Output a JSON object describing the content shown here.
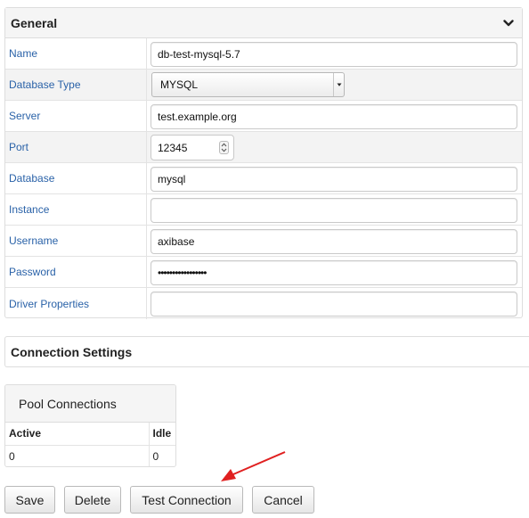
{
  "general": {
    "title": "General",
    "icon": "chevron-down-icon",
    "fields": [
      {
        "label": "Name",
        "value": "db-test-mysql-5.7",
        "type": "text"
      },
      {
        "label": "Database Type",
        "value": "MYSQL",
        "type": "select"
      },
      {
        "label": "Server",
        "value": "test.example.org",
        "type": "text"
      },
      {
        "label": "Port",
        "value": "12345",
        "type": "number"
      },
      {
        "label": "Database",
        "value": "mysql",
        "type": "text"
      },
      {
        "label": "Instance",
        "value": "",
        "type": "text"
      },
      {
        "label": "Username",
        "value": "axibase",
        "type": "text"
      },
      {
        "label": "Password",
        "value": "•••••••••••••••••",
        "type": "password"
      },
      {
        "label": "Driver Properties",
        "value": "",
        "type": "text"
      }
    ]
  },
  "connection_settings": {
    "title": "Connection Settings"
  },
  "pool": {
    "title": "Pool Connections",
    "headers": [
      "Active",
      "Idle"
    ],
    "rows": [
      [
        "0",
        "0"
      ]
    ]
  },
  "buttons": {
    "save": "Save",
    "delete": "Delete",
    "test": "Test Connection",
    "cancel": "Cancel"
  },
  "colors": {
    "label": "#2a62a8",
    "annotation_arrow": "#e02020"
  }
}
